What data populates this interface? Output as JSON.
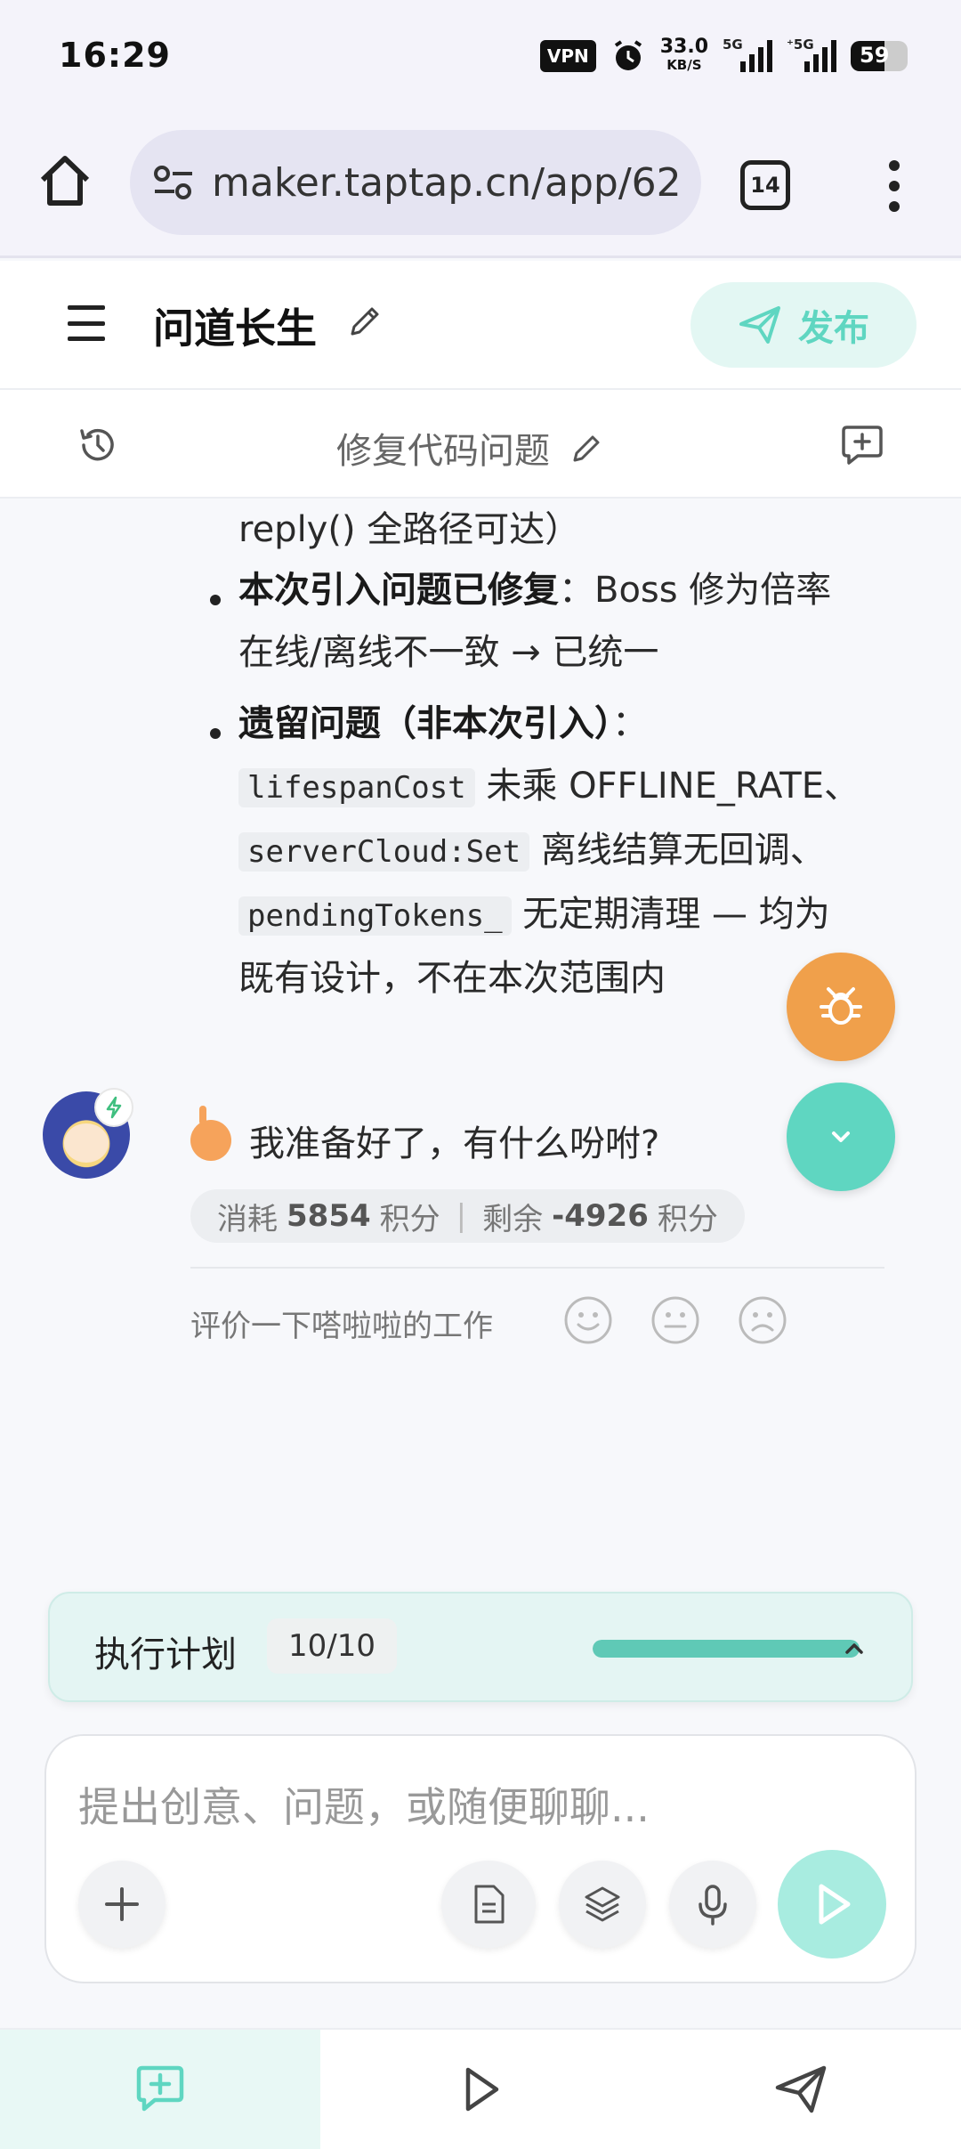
{
  "status_bar": {
    "time": "16:29",
    "vpn": "VPN",
    "speed_value": "33.0",
    "speed_unit": "KB/S",
    "net1": "5G",
    "net2": "⁺5G",
    "battery": "59",
    "battery_level": 0.59
  },
  "browser": {
    "url": "maker.taptap.cn/app/62",
    "tab_count": "14"
  },
  "header": {
    "title": "问道长生",
    "publish_label": "发布",
    "accent_color": "#5fd6c1"
  },
  "conversation": {
    "title": "修复代码问题"
  },
  "message": {
    "line0": "reply() 全路径可达）",
    "bullet1_bold": "本次引入问题已修复",
    "bullet1_rest": "：Boss 修为倍率",
    "bullet1_line2": "在线/离线不一致 → 已统一",
    "bullet2_bold": "遗留问题（非本次引入）",
    "bullet2_colon": "：",
    "code1": "lifespanCost",
    "text_after_code1": " 未乘 OFFLINE_RATE、",
    "code2": "serverCloud:Set",
    "text_after_code2": " 离线结算无回调、",
    "code3": "pendingTokens_",
    "text_after_code3": " 无定期清理 — 均为",
    "bullet2_last": "既有设计，不在本次范围内"
  },
  "reply": {
    "greeting": "我准备好了，有什么吩咐?",
    "cost_prefix": "消耗",
    "cost_value": "5854",
    "cost_unit": "积分",
    "remain_prefix": "剩余",
    "remain_value": "-4926",
    "remain_unit": "积分",
    "rate_label": "评价一下嗒啦啦的工作"
  },
  "plan": {
    "title": "执行计划",
    "count": "10/10",
    "progress": 1.0
  },
  "input": {
    "placeholder": "提出创意、问题，或随便聊聊..."
  }
}
